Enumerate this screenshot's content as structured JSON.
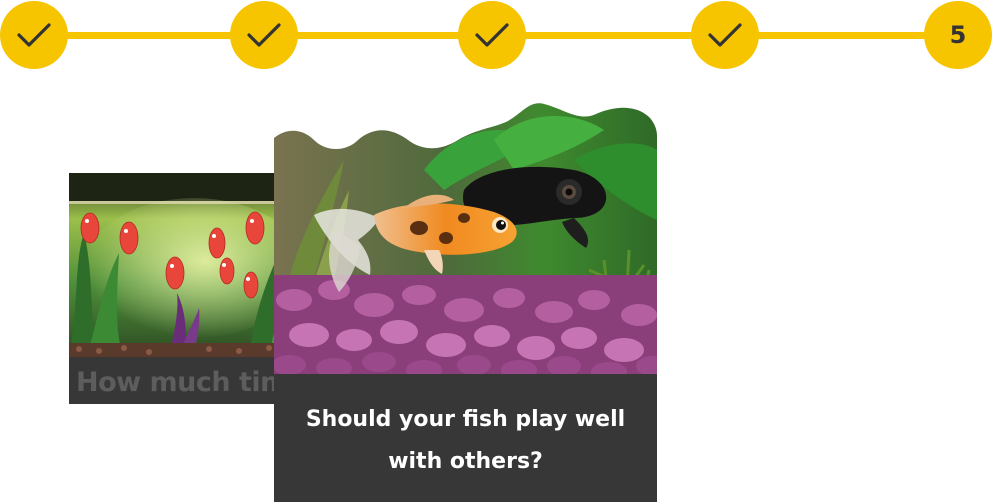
{
  "stepper": {
    "steps": [
      {
        "state": "completed",
        "icon": "check-icon"
      },
      {
        "state": "completed",
        "icon": "check-icon"
      },
      {
        "state": "completed",
        "icon": "check-icon"
      },
      {
        "state": "completed",
        "icon": "check-icon"
      },
      {
        "state": "current",
        "label": "5"
      }
    ],
    "accent_color": "#f7c400"
  },
  "cards": {
    "previous": {
      "title": "How much time"
    },
    "current": {
      "title": "Should your fish play well with others?"
    }
  }
}
